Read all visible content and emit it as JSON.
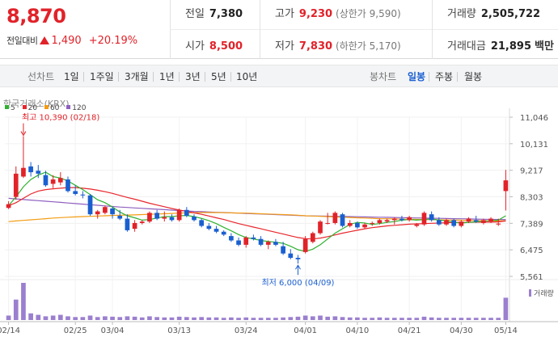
{
  "quote": {
    "current_price": "8,870",
    "change_label": "전일대비",
    "change_value": "1,490",
    "change_pct": "+20.19%",
    "prev_close_label": "전일",
    "prev_close": "7,380",
    "open_label": "시가",
    "open": "8,500",
    "high_label": "고가",
    "high": "9,230",
    "upper_limit_label": "(상한가 9,590)",
    "low_label": "저가",
    "low": "7,830",
    "lower_limit_label": "(하한가 5,170)",
    "volume_label": "거래량",
    "volume": "2,505,722",
    "turnover_label": "거래대금",
    "turnover": "21,895",
    "turnover_unit": "백만"
  },
  "toolbar": {
    "chart_type_label": "선차트",
    "range_buttons": [
      "1일",
      "1주일",
      "3개월",
      "1년",
      "3년",
      "5년",
      "10년"
    ],
    "candle_label": "봉차트",
    "candle_buttons": [
      "일봉",
      "주봉",
      "월봉"
    ],
    "active_candle": "일봉"
  },
  "legend": {
    "title": "한국거래소(KRX)",
    "items": [
      {
        "label": "5",
        "color": "#2fb12f"
      },
      {
        "label": "20",
        "color": "#e8262c"
      },
      {
        "label": "60",
        "color": "#f39c12"
      },
      {
        "label": "120",
        "color": "#8e5fbf"
      }
    ]
  },
  "colors": {
    "up": "#e12229",
    "down": "#1a5fd0",
    "ma5": "#2fb12f",
    "ma20": "#e8262c",
    "ma60": "#f39c12",
    "ma120": "#8e5fbf",
    "volume": "#9b7fcf"
  },
  "chart_data": {
    "type": "candlestick",
    "y_ticks": [
      "11,046",
      "10,131",
      "9,217",
      "8,303",
      "7,389",
      "6,475",
      "5,561"
    ],
    "ylim": [
      5561,
      11046
    ],
    "x_ticks": [
      "02/14",
      "02/25",
      "03/04",
      "03/13",
      "03/24",
      "04/01",
      "04/10",
      "04/21",
      "04/30",
      "05/14"
    ],
    "annotations": {
      "high": {
        "label": "최고",
        "value": "10,390 (02/18)"
      },
      "low": {
        "label": "최저",
        "value": "6,000 (04/09)"
      }
    },
    "volume_label": "거래량",
    "candles": [
      [
        7920,
        8150,
        7880,
        8050
      ],
      [
        8300,
        9350,
        8200,
        9100
      ],
      [
        9000,
        10390,
        8950,
        9300
      ],
      [
        9350,
        9500,
        9000,
        9150
      ],
      [
        9200,
        9400,
        8950,
        9100
      ],
      [
        9050,
        9200,
        8650,
        8700
      ],
      [
        8750,
        9050,
        8600,
        8900
      ],
      [
        8800,
        9150,
        8700,
        8950
      ],
      [
        8900,
        9000,
        8450,
        8500
      ],
      [
        8500,
        8700,
        8350,
        8400
      ],
      [
        8380,
        8500,
        8250,
        8350
      ],
      [
        8350,
        8400,
        7650,
        7700
      ],
      [
        7700,
        7850,
        7550,
        7800
      ],
      [
        7750,
        8000,
        7700,
        7950
      ],
      [
        7900,
        7950,
        7550,
        7700
      ],
      [
        7650,
        7850,
        7500,
        7550
      ],
      [
        7550,
        7700,
        7100,
        7150
      ],
      [
        7200,
        7500,
        7100,
        7400
      ],
      [
        7400,
        7500,
        7350,
        7450
      ],
      [
        7450,
        7800,
        7400,
        7750
      ],
      [
        7750,
        7850,
        7500,
        7550
      ],
      [
        7550,
        7800,
        7450,
        7600
      ],
      [
        7600,
        7700,
        7450,
        7500
      ],
      [
        7500,
        7900,
        7450,
        7850
      ],
      [
        7850,
        7950,
        7600,
        7650
      ],
      [
        7620,
        7700,
        7450,
        7500
      ],
      [
        7500,
        7550,
        7250,
        7300
      ],
      [
        7300,
        7400,
        7150,
        7200
      ],
      [
        7200,
        7300,
        7050,
        7100
      ],
      [
        7100,
        7150,
        6950,
        7000
      ],
      [
        6950,
        7050,
        6750,
        6800
      ],
      [
        6800,
        6900,
        6600,
        6650
      ],
      [
        6650,
        6950,
        6550,
        6900
      ],
      [
        6900,
        7000,
        6800,
        6850
      ],
      [
        6850,
        6950,
        6600,
        6650
      ],
      [
        6650,
        6800,
        6500,
        6750
      ],
      [
        6750,
        6850,
        6600,
        6650
      ],
      [
        6600,
        6750,
        6300,
        6350
      ],
      [
        6350,
        6500,
        6150,
        6200
      ],
      [
        6200,
        6300,
        6000,
        6150
      ],
      [
        6400,
        6950,
        6350,
        6850
      ],
      [
        6750,
        7100,
        6700,
        7050
      ],
      [
        7050,
        7500,
        7000,
        7450
      ],
      [
        7400,
        7750,
        7350,
        7400
      ],
      [
        7400,
        7800,
        7350,
        7750
      ],
      [
        7700,
        7750,
        7250,
        7300
      ],
      [
        7300,
        7500,
        7250,
        7400
      ],
      [
        7400,
        7450,
        7200,
        7250
      ],
      [
        7250,
        7400,
        7200,
        7350
      ],
      [
        7380,
        7450,
        7300,
        7400
      ],
      [
        7400,
        7550,
        7350,
        7500
      ],
      [
        7450,
        7550,
        7400,
        7500
      ],
      [
        7500,
        7600,
        7350,
        7550
      ],
      [
        7550,
        7650,
        7450,
        7500
      ],
      [
        7500,
        7650,
        7450,
        7600
      ],
      [
        7300,
        7400,
        7250,
        7350
      ],
      [
        7350,
        7800,
        7300,
        7750
      ],
      [
        7700,
        7800,
        7450,
        7500
      ],
      [
        7500,
        7600,
        7300,
        7350
      ],
      [
        7350,
        7550,
        7300,
        7500
      ],
      [
        7500,
        7550,
        7250,
        7300
      ],
      [
        7300,
        7500,
        7250,
        7450
      ],
      [
        7450,
        7600,
        7400,
        7550
      ],
      [
        7500,
        7650,
        7400,
        7450
      ],
      [
        7400,
        7550,
        7350,
        7500
      ],
      [
        7450,
        7600,
        7400,
        7550
      ],
      [
        7350,
        7550,
        7300,
        7380
      ],
      [
        8500,
        9230,
        7830,
        8870
      ]
    ],
    "volume": [
      12,
      55,
      100,
      18,
      14,
      10,
      12,
      14,
      10,
      8,
      8,
      12,
      8,
      10,
      9,
      8,
      10,
      9,
      7,
      10,
      8,
      7,
      7,
      9,
      8,
      7,
      8,
      7,
      7,
      6,
      7,
      6,
      7,
      6,
      6,
      6,
      6,
      7,
      8,
      9,
      12,
      10,
      12,
      9,
      10,
      8,
      7,
      7,
      6,
      6,
      7,
      6,
      6,
      6,
      6,
      6,
      9,
      7,
      6,
      6,
      6,
      6,
      6,
      6,
      6,
      6,
      6,
      60
    ],
    "ma5": [
      8000,
      8300,
      8650,
      8900,
      9050,
      9150,
      9000,
      8950,
      8850,
      8700,
      8550,
      8380,
      8200,
      8100,
      7950,
      7780,
      7650,
      7580,
      7500,
      7520,
      7570,
      7620,
      7620,
      7650,
      7660,
      7620,
      7560,
      7480,
      7380,
      7250,
      7130,
      7000,
      6900,
      6850,
      6800,
      6760,
      6740,
      6700,
      6600,
      6480,
      6420,
      6500,
      6650,
      6850,
      7050,
      7200,
      7350,
      7420,
      7400,
      7350,
      7380,
      7420,
      7450,
      7500,
      7520,
      7500,
      7520,
      7540,
      7500,
      7480,
      7420,
      7400,
      7420,
      7440,
      7460,
      7480,
      7500,
      7650
    ],
    "ma20": [
      8000,
      8100,
      8250,
      8400,
      8500,
      8550,
      8580,
      8600,
      8620,
      8620,
      8600,
      8570,
      8530,
      8480,
      8420,
      8350,
      8280,
      8220,
      8150,
      8080,
      8020,
      7960,
      7900,
      7850,
      7800,
      7750,
      7700,
      7640,
      7580,
      7520,
      7450,
      7380,
      7320,
      7260,
      7200,
      7140,
      7080,
      7020,
      6960,
      6900,
      6860,
      6850,
      6880,
      6930,
      6990,
      7050,
      7100,
      7150,
      7200,
      7240,
      7270,
      7300,
      7320,
      7340,
      7360,
      7370,
      7380,
      7390,
      7400,
      7410,
      7420,
      7420,
      7420,
      7430,
      7430,
      7430,
      7440,
      7470
    ],
    "ma60": [
      7450,
      7470,
      7490,
      7510,
      7530,
      7550,
      7570,
      7585,
      7600,
      7610,
      7620,
      7630,
      7640,
      7650,
      7660,
      7670,
      7675,
      7680,
      7690,
      7700,
      7710,
      7720,
      7730,
      7740,
      7750,
      7755,
      7760,
      7760,
      7760,
      7755,
      7750,
      7745,
      7740,
      7730,
      7720,
      7710,
      7700,
      7690,
      7680,
      7670,
      7650,
      7640,
      7630,
      7620,
      7610,
      7600,
      7590,
      7580,
      7570,
      7560,
      7550,
      7545,
      7540,
      7535,
      7530,
      7525,
      7520,
      7515,
      7510,
      7505,
      7500,
      7495,
      7490,
      7485,
      7480,
      7475,
      7470,
      7480
    ],
    "ma120": [
      8250,
      8230,
      8210,
      8190,
      8170,
      8150,
      8130,
      8110,
      8090,
      8070,
      8050,
      8030,
      8010,
      7990,
      7970,
      7950,
      7935,
      7920,
      7905,
      7890,
      7875,
      7860,
      7845,
      7830,
      7815,
      7800,
      7790,
      7780,
      7770,
      7760,
      7750,
      7740,
      7730,
      7720,
      7710,
      7700,
      7690,
      7680,
      7670,
      7660,
      7650,
      7645,
      7640,
      7635,
      7630,
      7625,
      7620,
      7615,
      7610,
      7605,
      7600,
      7595,
      7590,
      7585,
      7580,
      7575,
      7570,
      7565,
      7560,
      7555,
      7550,
      7545,
      7540,
      7535,
      7530,
      7525,
      7520,
      7520
    ]
  }
}
